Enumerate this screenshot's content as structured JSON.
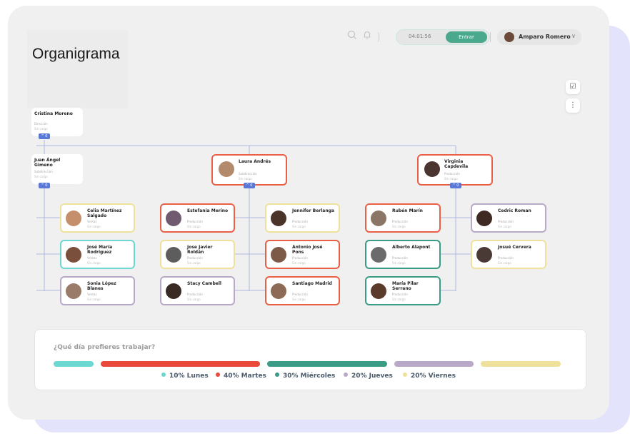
{
  "page": {
    "title": "Organigrama"
  },
  "topbar": {
    "timer": "04:01:56",
    "enter_label": "Entrar",
    "user_name": "Amparo Romero",
    "search_icon": "search-icon",
    "bell_icon": "bell-icon"
  },
  "tools": {
    "checklist_icon": "checklist-icon",
    "more_icon": "more-vertical-icon"
  },
  "org": {
    "top": {
      "name": "Cristina Moreno",
      "dept": "Dirección",
      "role": "Sin cargo",
      "toggle": "^ 0"
    },
    "sub": [
      {
        "name": "Juan Ángel Gimeno",
        "dept": "Subdirección",
        "role": "Sin cargo",
        "toggle": "^ 0"
      },
      {
        "name": "Laura Andrés",
        "dept": "Subdirección",
        "role": "Sin cargo",
        "toggle": "^ 0"
      },
      {
        "name": "Virginia Capdevila",
        "dept": "Producción",
        "role": "Sin cargo",
        "toggle": "^ 0"
      }
    ],
    "members": [
      {
        "name": "Celia Martínez Salgado",
        "dept": "Ventas",
        "role": "Sin cargo",
        "color": "#efe19b"
      },
      {
        "name": "José María Rodríguez",
        "dept": "Ventas",
        "role": "Sin cargo",
        "color": "#6dd7d1"
      },
      {
        "name": "Sonia López Blanes",
        "dept": "Ventas",
        "role": "Sin cargo",
        "color": "#b9a9c9"
      },
      {
        "name": "Estefanía Merino",
        "dept": "Producción",
        "role": "Sin cargo",
        "color": "#e96046"
      },
      {
        "name": "Jose Javier Roldán",
        "dept": "Producción",
        "role": "Sin cargo",
        "color": "#efe19b"
      },
      {
        "name": "Stacy Cambell",
        "dept": "Producción",
        "role": "Sin cargo",
        "color": "#b9a9c9"
      },
      {
        "name": "Jennifer Berlanga",
        "dept": "Producción",
        "role": "Sin cargo",
        "color": "#efe19b"
      },
      {
        "name": "Antonio José Pons",
        "dept": "Producción",
        "role": "Sin cargo",
        "color": "#e96046"
      },
      {
        "name": "Santiago Madrid",
        "dept": "Producción",
        "role": "Sin cargo",
        "color": "#e96046"
      },
      {
        "name": "Rubén Marín",
        "dept": "Producción",
        "role": "Sin cargo",
        "color": "#e96046"
      },
      {
        "name": "Alberto Alapont",
        "dept": "Producción",
        "role": "Sin cargo",
        "color": "#3b9c85"
      },
      {
        "name": "María Pilar Serrano",
        "dept": "Producción",
        "role": "Sin cargo",
        "color": "#3b9c85"
      },
      {
        "name": "Cedric Roman",
        "dept": "Producción",
        "role": "Sin cargo",
        "color": "#b9a9c9"
      },
      {
        "name": "Josué Cervera",
        "dept": "Producción",
        "role": "Sin cargo",
        "color": "#efe19b"
      }
    ]
  },
  "poll": {
    "question": "¿Qué día prefieres trabajar?",
    "options": [
      {
        "label": "10% Lunes",
        "percent": 10,
        "color": "#6dd7d1"
      },
      {
        "label": "40% Martes",
        "percent": 40,
        "color": "#e9493b"
      },
      {
        "label": "30% Miércoles",
        "percent": 30,
        "color": "#3b9c85"
      },
      {
        "label": "20% Jueves",
        "percent": 20,
        "color": "#b9a9c9"
      },
      {
        "label": "20% Viernes",
        "percent": 20,
        "color": "#efe19b"
      }
    ]
  }
}
